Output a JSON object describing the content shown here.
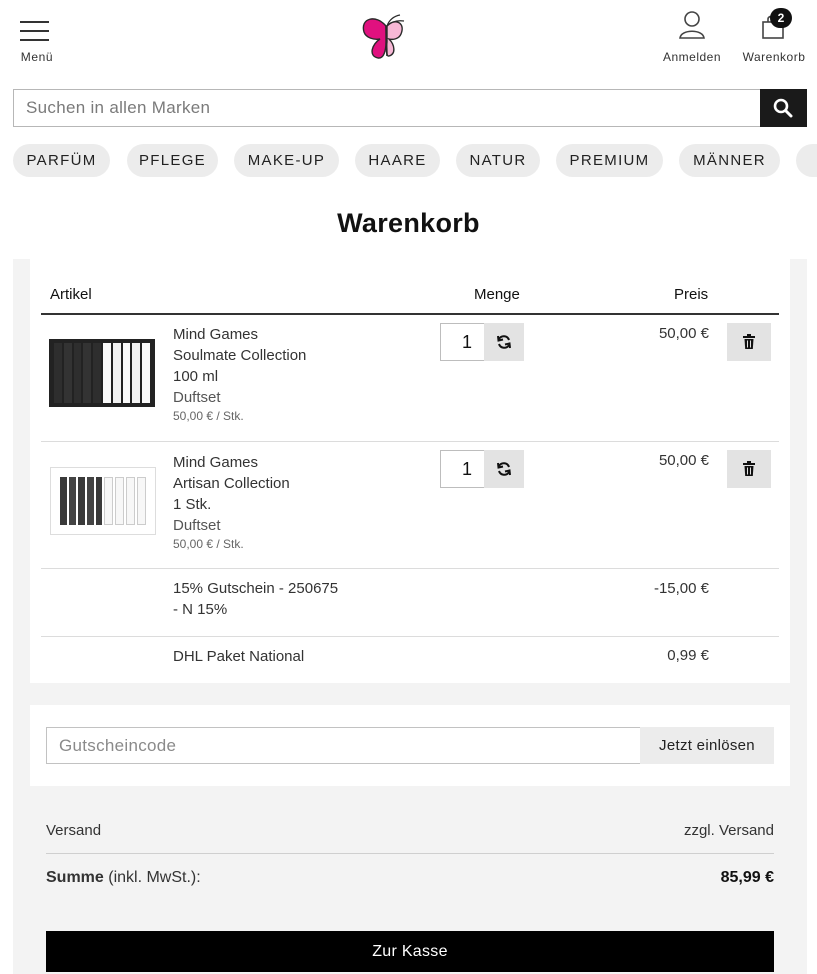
{
  "header": {
    "menu_label": "Menü",
    "account_label": "Anmelden",
    "cart_label": "Warenkorb",
    "cart_count": "2",
    "brand_color": "#e0117f"
  },
  "search": {
    "placeholder": "Suchen in allen Marken"
  },
  "categories": [
    "PARFÜM",
    "PFLEGE",
    "MAKE-UP",
    "HAARE",
    "NATUR",
    "PREMIUM",
    "MÄNNER"
  ],
  "page_title": "Warenkorb",
  "table": {
    "col_article": "Artikel",
    "col_qty": "Menge",
    "col_price": "Preis"
  },
  "items": [
    {
      "brand": "Mind Games",
      "name": "Soulmate Collection",
      "size": "100 ml",
      "type": "Duftset",
      "unit_price": "50,00 € / Stk.",
      "qty": "1",
      "price": "50,00 €"
    },
    {
      "brand": "Mind Games",
      "name": "Artisan Collection",
      "size": "1 Stk.",
      "type": "Duftset",
      "unit_price": "50,00 € / Stk.",
      "qty": "1",
      "price": "50,00 €"
    }
  ],
  "voucher": {
    "line1": "15% Gutschein - 250675",
    "line2": "- N 15%",
    "price": "-15,00 €"
  },
  "shipping": {
    "label": "DHL Paket National",
    "price": "0,99 €"
  },
  "coupon": {
    "placeholder": "Gutscheincode",
    "button": "Jetzt einlösen"
  },
  "summary": {
    "shipping_label": "Versand",
    "shipping_value": "zzgl. Versand",
    "total_label": "Summe",
    "total_note": "(inkl. MwSt.):",
    "total_value": "85,99 €"
  },
  "checkout_label": "Zur Kasse"
}
